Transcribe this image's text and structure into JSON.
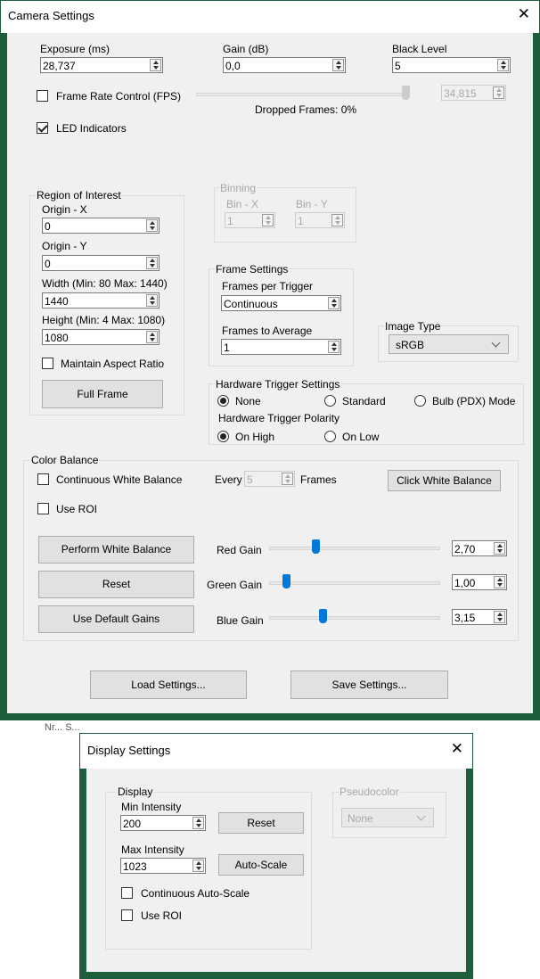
{
  "camera_window": {
    "title": "Camera Settings",
    "close_glyph": "✕",
    "exposure": {
      "label": "Exposure (ms)",
      "value": "28,737"
    },
    "gain": {
      "label": "Gain (dB)",
      "value": "0,0"
    },
    "black_level": {
      "label": "Black Level",
      "value": "5"
    },
    "frame_rate": {
      "label": "Frame Rate Control (FPS)",
      "checked": false,
      "value": "34,815",
      "dropped_frames": "Dropped Frames: 0%"
    },
    "led_indicators": {
      "label": "LED Indicators",
      "checked": true
    },
    "roi": {
      "title": "Region of Interest",
      "origin_x": {
        "label": "Origin - X",
        "value": "0"
      },
      "origin_y": {
        "label": "Origin - Y",
        "value": "0"
      },
      "width": {
        "label": "Width  (Min: 80 Max: 1440)",
        "value": "1440"
      },
      "height": {
        "label": "Height (Min: 4 Max: 1080)",
        "value": "1080"
      },
      "maintain_aspect": {
        "label": "Maintain Aspect Ratio",
        "checked": false
      },
      "full_frame_button": "Full Frame"
    },
    "binning": {
      "title": "Binning",
      "bin_x": {
        "label": "Bin - X",
        "value": "1"
      },
      "bin_y": {
        "label": "Bin - Y",
        "value": "1"
      }
    },
    "frame_settings": {
      "title": "Frame Settings",
      "frames_per_trigger": {
        "label": "Frames per Trigger",
        "value": "Continuous"
      },
      "frames_to_average": {
        "label": "Frames to Average",
        "value": "1"
      }
    },
    "image_type": {
      "label": "Image Type",
      "value": "sRGB"
    },
    "hardware_trigger": {
      "title": "Hardware Trigger Settings",
      "modes": [
        "None",
        "Standard",
        "Bulb (PDX) Mode"
      ],
      "selected_mode": "None",
      "polarity_label": "Hardware Trigger Polarity",
      "polarities": [
        "On High",
        "On Low"
      ],
      "selected_polarity": "On High"
    },
    "color_balance": {
      "title": "Color Balance",
      "continuous_wb": {
        "label": "Continuous White Balance",
        "checked": false
      },
      "every_label": "Every",
      "every_value": "5",
      "frames_label": "Frames",
      "click_wb_button": "Click White Balance",
      "use_roi": {
        "label": "Use ROI",
        "checked": false
      },
      "perform_wb_button": "Perform White Balance",
      "reset_button": "Reset",
      "default_gains_button": "Use Default Gains",
      "red_gain": {
        "label": "Red Gain",
        "value": "2,70",
        "slider_fraction": 0.27
      },
      "green_gain": {
        "label": "Green Gain",
        "value": "1,00",
        "slider_fraction": 0.1
      },
      "blue_gain": {
        "label": "Blue Gain",
        "value": "3,15",
        "slider_fraction": 0.31
      }
    },
    "load_button": "Load Settings...",
    "save_button": "Save Settings..."
  },
  "display_window": {
    "title": "Display Settings",
    "close_glyph": "✕",
    "display_group": "Display",
    "min_intensity": {
      "label": "Min Intensity",
      "value": "200"
    },
    "max_intensity": {
      "label": "Max Intensity",
      "value": "1023"
    },
    "reset_button": "Reset",
    "autoscale_button": "Auto-Scale",
    "continuous_autoscale": {
      "label": "Continuous Auto-Scale",
      "checked": false
    },
    "use_roi": {
      "label": "Use ROI",
      "checked": false
    },
    "pseudocolor": {
      "label": "Pseudocolor",
      "value": "None"
    }
  },
  "background_fragment": "Nr...   S..."
}
